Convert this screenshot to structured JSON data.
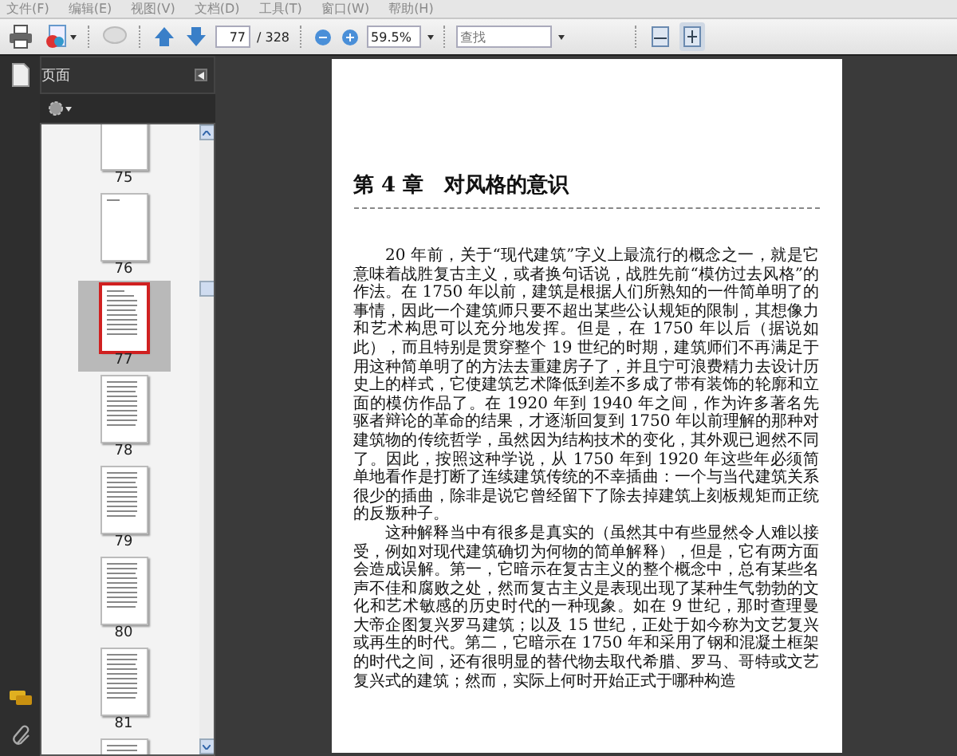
{
  "menu": [
    "文件(F)",
    "编辑(E)",
    "视图(V)",
    "文档(D)",
    "工具(T)",
    "窗口(W)",
    "帮助(H)"
  ],
  "toolbar": {
    "page_field": {
      "value": "77"
    },
    "page_count": "/ 328",
    "zoom_field": {
      "value": "59.5%"
    },
    "find_field": {
      "placeholder": "查找"
    },
    "view_buttons": [
      {
        "kind": "fit-width",
        "selected": false
      },
      {
        "kind": "fit-page",
        "selected": true
      }
    ]
  },
  "sidebar": {
    "title": "页面",
    "thumbnails": [
      {
        "label": "75",
        "kind": "blank",
        "selected": false
      },
      {
        "label": "76",
        "kind": "title",
        "selected": false
      },
      {
        "label": "77",
        "kind": "chapter",
        "selected": true
      },
      {
        "label": "78",
        "kind": "text",
        "selected": false
      },
      {
        "label": "79",
        "kind": "text",
        "selected": false
      },
      {
        "label": "80",
        "kind": "text",
        "selected": false
      },
      {
        "label": "81",
        "kind": "text",
        "selected": false
      },
      {
        "kind": "text",
        "selected": false
      }
    ]
  },
  "document": {
    "heading": "第 4 章　对风格的意识",
    "paragraphs": [
      "20 年前，关于“现代建筑”字义上最流行的概念之一，就是它意味着战胜复古主义，或者换句话说，战胜先前“模仿过去风格”的作法。在 1750 年以前，建筑是根据人们所熟知的一件简单明了的事情，因此一个建筑师只要不超出某些公认规矩的限制，其想像力和艺术构思可以充分地发挥。但是，在 1750 年以后（据说如此），而且特别是贯穿整个 19 世纪的时期，建筑师们不再满足于用这种简单明了的方法去重建房子了，并且宁可浪费精力去设计历史上的样式，它使建筑艺术降低到差不多成了带有装饰的轮廓和立面的模仿作品了。在 1920 年到 1940 年之间，作为许多著名先驱者辩论的革命的结果，才逐渐回复到 1750 年以前理解的那种对建筑物的传统哲学，虽然因为结构技术的变化，其外观已迥然不同了。因此，按照这种学说，从 1750 年到 1920 年这些年必须简单地看作是打断了连续建筑传统的不幸插曲：一个与当代建筑关系很少的插曲，除非是说它曾经留下了除去掉建筑上刻板规矩而正统的反叛种子。",
      "这种解释当中有很多是真实的（虽然其中有些显然令人难以接受，例如对现代建筑确切为何物的简单解释），但是，它有两方面会造成误解。第一，它暗示在复古主义的整个概念中，总有某些名声不佳和腐败之处，然而复古主义是表现出现了某种生气勃勃的文化和艺术敏感的历史时代的一种现象。如在 9 世纪，那时查理曼大帝企图复兴罗马建筑；以及 15 世纪，正处于如今称为文艺复兴或再生的时代。第二，它暗示在 1750 年和采用了钢和混凝土框架的时代之间，还有很明显的替代物去取代希腊、罗马、哥特或文艺复兴式的建筑；然而，实际上何时开始正式于哪种构造"
    ]
  }
}
